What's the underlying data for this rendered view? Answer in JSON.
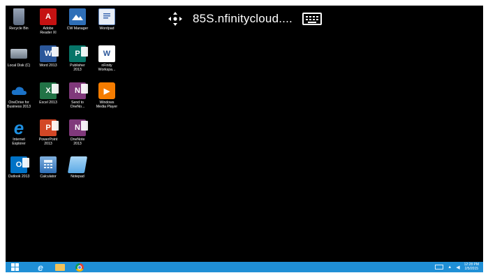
{
  "remote_session": {
    "title": "85S.nfinitycloud...."
  },
  "desktop_icons": [
    {
      "label": "Recycle Bin",
      "icon": "recycle-bin-icon",
      "glyph": ""
    },
    {
      "label": "Adobe\nReader XI",
      "icon": "adobe-reader-icon",
      "glyph": "A"
    },
    {
      "label": "CW Manager",
      "icon": "cw-manager-icon",
      "glyph": ""
    },
    {
      "label": "Wordpad",
      "icon": "wordpad-icon",
      "glyph": ""
    },
    {
      "label": "Local Disk (C)",
      "icon": "local-disk-icon",
      "glyph": ""
    },
    {
      "label": "Word 2013",
      "icon": "word-icon",
      "glyph": "W"
    },
    {
      "label": "Publisher\n2013",
      "icon": "publisher-icon",
      "glyph": "P"
    },
    {
      "label": "nFinity\nWorkspa...",
      "icon": "nfinity-workspace-icon",
      "glyph": "W"
    },
    {
      "label": "OneDrive for\nBusiness 2013",
      "icon": "onedrive-icon",
      "glyph": ""
    },
    {
      "label": "Excel 2013",
      "icon": "excel-icon",
      "glyph": "X"
    },
    {
      "label": "Send to\nOneNo...",
      "icon": "send-to-onenote-icon",
      "glyph": "N"
    },
    {
      "label": "Windows\nMedia Player",
      "icon": "media-player-icon",
      "glyph": "▶"
    },
    {
      "label": "Internet\nExplorer",
      "icon": "internet-explorer-icon",
      "glyph": "e"
    },
    {
      "label": "PowerPoint\n2013",
      "icon": "powerpoint-icon",
      "glyph": "P"
    },
    {
      "label": "OneNote\n2013",
      "icon": "onenote-icon",
      "glyph": "N"
    },
    {
      "label": "",
      "icon": "",
      "glyph": ""
    },
    {
      "label": "Outlook 2013",
      "icon": "outlook-icon",
      "glyph": "O"
    },
    {
      "label": "Calculator",
      "icon": "calculator-icon",
      "glyph": ""
    },
    {
      "label": "Notepad",
      "icon": "notepad-icon",
      "glyph": ""
    }
  ],
  "taskbar": {
    "pinned": [
      {
        "icon": "start-windows-icon"
      },
      {
        "icon": "internet-explorer-icon"
      },
      {
        "icon": "file-explorer-icon"
      },
      {
        "icon": "chrome-icon"
      }
    ],
    "clock_time": "12:28 PM",
    "clock_date": "2/5/2015"
  },
  "colors": {
    "desktop_bg": "#000000",
    "taskbar_bg": "#1f8fd6",
    "frame_bg": "#ffffff"
  }
}
